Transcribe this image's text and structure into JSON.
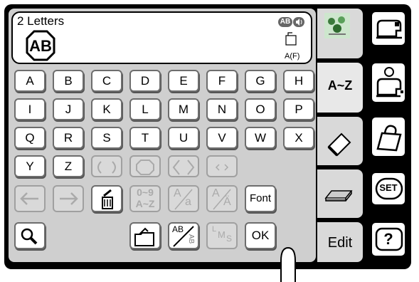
{
  "display": {
    "title": "2 Letters",
    "monogram": "AB",
    "badge": "AB",
    "font_code": "A(F)"
  },
  "keyboard": {
    "rows": [
      [
        "A",
        "B",
        "C",
        "D",
        "E",
        "F",
        "G",
        "H"
      ],
      [
        "I",
        "J",
        "K",
        "L",
        "M",
        "N",
        "O",
        "P"
      ],
      [
        "Q",
        "R",
        "S",
        "T",
        "U",
        "V",
        "W",
        "X"
      ],
      [
        "Y",
        "Z"
      ]
    ],
    "frames": [
      "round-frame-icon",
      "octagon-frame-icon",
      "diamond-frame-icon",
      "angle-frame-icon"
    ],
    "controls": {
      "numeric_top": "0~9",
      "numeric_bottom": "A~Z",
      "case_upper": "A",
      "case_lower": "a",
      "accent_upper": "A",
      "accent_lower": "Ä",
      "font": "Font",
      "ok": "OK",
      "ab_top": "AB",
      "ab_bottom": "AB",
      "size_l": "L",
      "size_m": "M",
      "size_s": "S"
    }
  },
  "tabs": {
    "az": "A~Z",
    "edit": "Edit"
  },
  "side": {
    "set": "SET",
    "help": "?"
  }
}
